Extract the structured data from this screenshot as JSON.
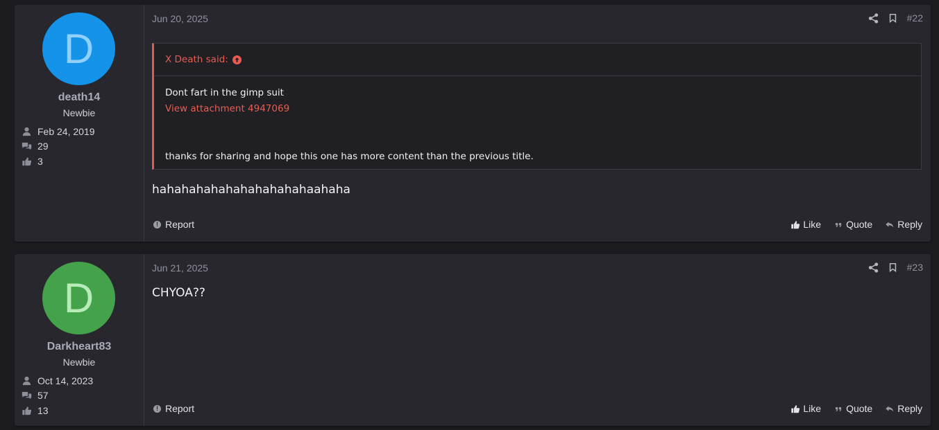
{
  "posts": [
    {
      "date": "Jun 20, 2025",
      "number": "#22",
      "user": {
        "avatar_letter": "D",
        "avatar_bg": "#1493e8",
        "avatar_fg": "#8fd0ff",
        "name": "death14",
        "title": "Newbie",
        "joined": "Feb 24, 2019",
        "messages": "29",
        "reactions": "3"
      },
      "quote": {
        "author": "X Death said:",
        "line1": "Dont fart in the gimp suit",
        "link": "View attachment 4947069",
        "line2": "thanks for sharing and hope this one has more content than the previous title."
      },
      "message": "hahahahahahahahahahahaahaha",
      "actions": {
        "report": "Report",
        "like": "Like",
        "quote": "Quote",
        "reply": "Reply"
      }
    },
    {
      "date": "Jun 21, 2025",
      "number": "#23",
      "user": {
        "avatar_letter": "D",
        "avatar_bg": "#43a24a",
        "avatar_fg": "#b7ecb9",
        "name": "Darkheart83",
        "title": "Newbie",
        "joined": "Oct 14, 2023",
        "messages": "57",
        "reactions": "13"
      },
      "message": "CHYOA??",
      "actions": {
        "report": "Report",
        "like": "Like",
        "quote": "Quote",
        "reply": "Reply"
      }
    }
  ],
  "icons": {
    "share": "share-icon",
    "bookmark": "bookmark-icon",
    "user": "user-icon",
    "messages": "comments-icon",
    "reactions": "thumbs-up-icon"
  }
}
